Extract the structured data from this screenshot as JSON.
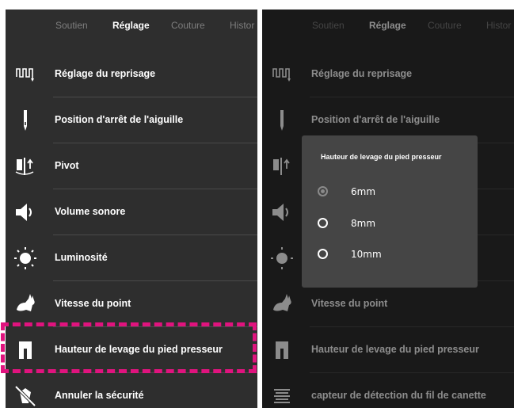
{
  "tabs": [
    "Soutien",
    "Réglage",
    "Couture",
    "Histor"
  ],
  "active_tab_index": 1,
  "settings": {
    "items": [
      {
        "label": "Réglage du reprisage",
        "icon": "darning-icon"
      },
      {
        "label": "Position d'arrêt de l'aiguille",
        "icon": "needle-icon"
      },
      {
        "label": "Pivot",
        "icon": "pivot-icon"
      },
      {
        "label": "Volume sonore",
        "icon": "speaker-icon"
      },
      {
        "label": "Luminosité",
        "icon": "brightness-icon"
      },
      {
        "label": "Vitesse du point",
        "icon": "rabbit-icon"
      },
      {
        "label": "Hauteur de levage du pied presseur",
        "icon": "presser-foot-icon"
      },
      {
        "label": "Annuler la sécurité",
        "icon": "cancel-safety-icon"
      }
    ],
    "right_last_item": {
      "label": "capteur de détection du fil de canette",
      "icon": "bobbin-sensor-icon"
    }
  },
  "dialog": {
    "title": "Hauteur de levage du pied presseur",
    "options": [
      {
        "label": "6mm",
        "selected": true
      },
      {
        "label": "8mm",
        "selected": false
      },
      {
        "label": "10mm",
        "selected": false
      }
    ]
  },
  "colors": {
    "background": "#2e2e2e",
    "highlight": "#e0137e",
    "dialog": "#454545"
  }
}
